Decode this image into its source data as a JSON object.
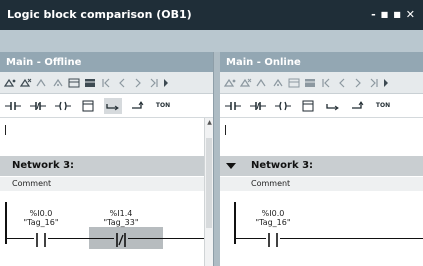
{
  "window": {
    "title": "Logic block comparison (OB1)",
    "controls": [
      "-",
      "■",
      "■",
      "✕"
    ]
  },
  "left_pane": {
    "title": "Main - Offline",
    "network_title": "Network 3:",
    "comment": "Comment",
    "contacts": [
      {
        "address": "%I0.0",
        "tag": "\"Tag_16\""
      },
      {
        "address": "%I1.4",
        "tag": "\"Tag_33\""
      }
    ]
  },
  "right_pane": {
    "title": "Main - Online",
    "network_title": "Network 3:",
    "comment": "Comment",
    "contacts": [
      {
        "address": "%I0.0",
        "tag": "\"Tag_16\""
      }
    ]
  },
  "ladder_toolbar": {
    "ton_label": "TON"
  },
  "colors": {
    "titlebar": "#1f2e38",
    "pane_header": "#93a7b3",
    "network_bar": "#c9ced1",
    "highlight": "#b7bcbf"
  }
}
